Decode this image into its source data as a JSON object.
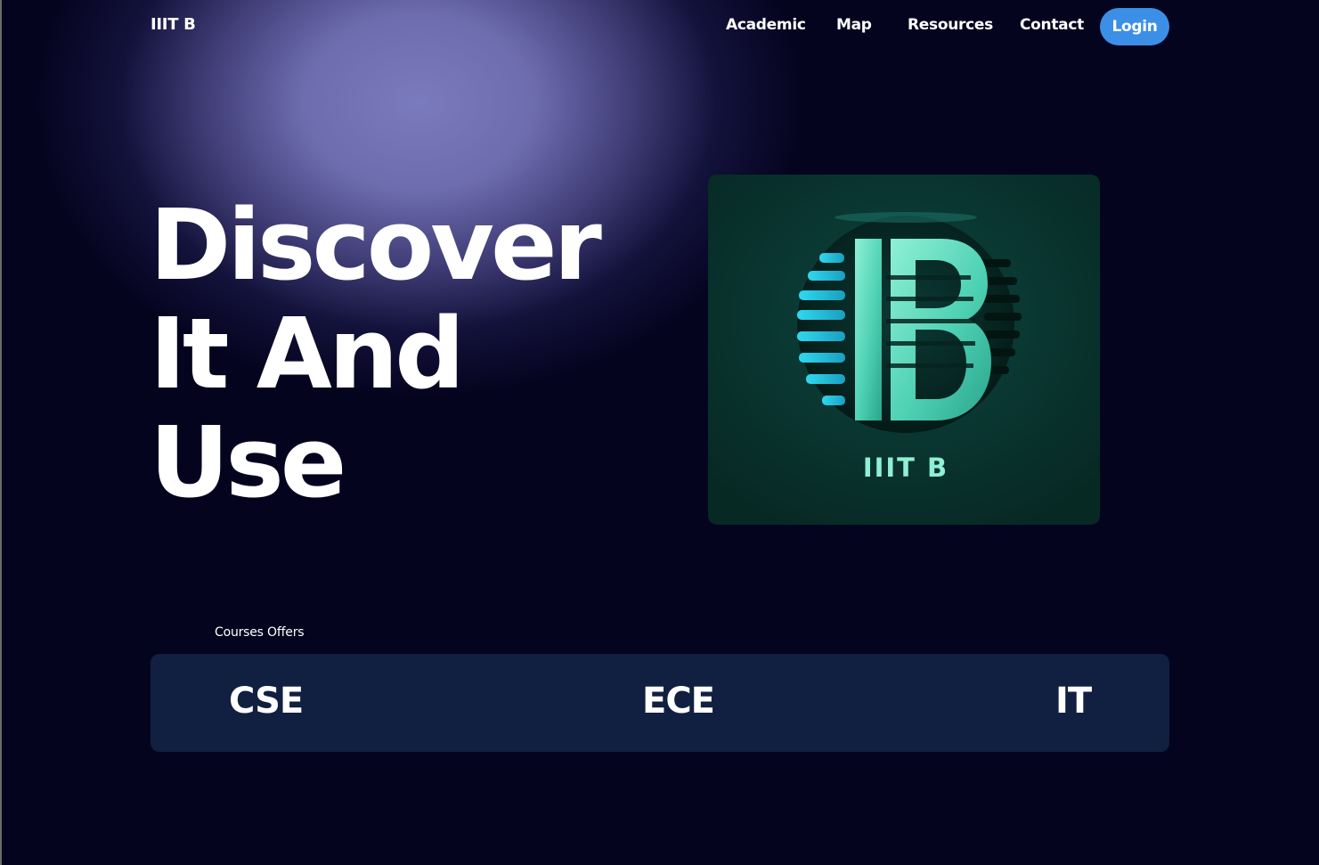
{
  "brand": "IIIT B",
  "nav": {
    "links": [
      "Academic",
      "Map",
      "Resources",
      "Contact"
    ],
    "login": "Login"
  },
  "hero": {
    "lines": [
      "Discover",
      "It And",
      "Use"
    ]
  },
  "logo": {
    "text": "IIIT B",
    "icon": "iiitb-logo"
  },
  "courses": {
    "label": "Courses Offers",
    "items": [
      "CSE",
      "ECE",
      "IT"
    ]
  },
  "colors": {
    "background": "#05041f",
    "glow": "#7a7abe",
    "login_button": "#3b8fe6",
    "courses_bar": "#111f40",
    "logo_accent": "#33e0c0"
  }
}
